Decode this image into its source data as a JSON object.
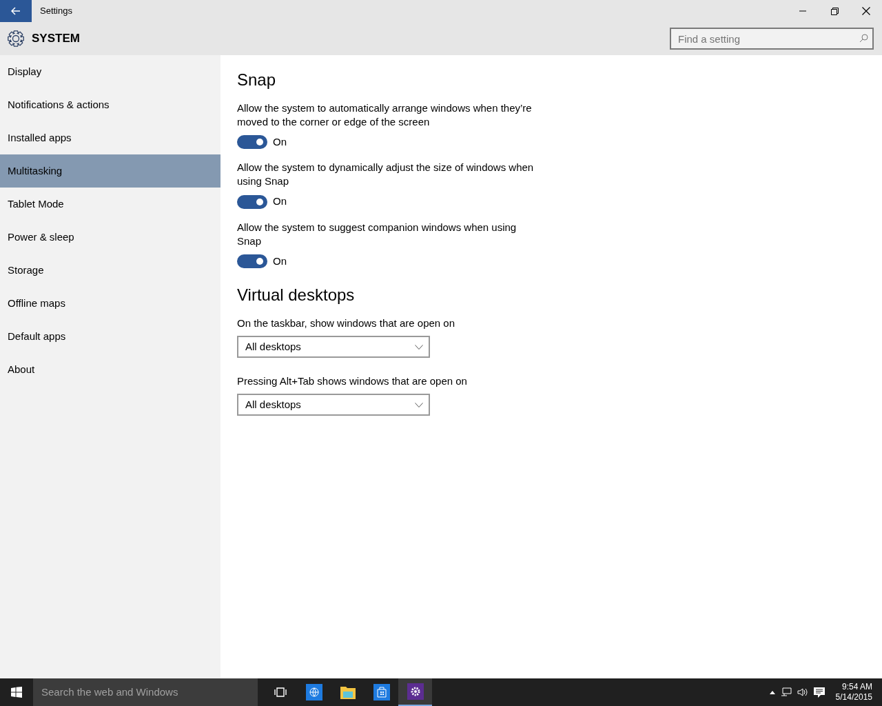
{
  "window": {
    "title": "Settings"
  },
  "header": {
    "title": "SYSTEM",
    "search": {
      "placeholder": "Find a setting"
    }
  },
  "sidebar": {
    "items": [
      {
        "label": "Display",
        "selected": false
      },
      {
        "label": "Notifications & actions",
        "selected": false
      },
      {
        "label": "Installed apps",
        "selected": false
      },
      {
        "label": "Multitasking",
        "selected": true
      },
      {
        "label": "Tablet Mode",
        "selected": false
      },
      {
        "label": "Power & sleep",
        "selected": false
      },
      {
        "label": "Storage",
        "selected": false
      },
      {
        "label": "Offline maps",
        "selected": false
      },
      {
        "label": "Default apps",
        "selected": false
      },
      {
        "label": "About",
        "selected": false
      }
    ]
  },
  "sections": [
    {
      "title": "Snap",
      "settings": [
        {
          "kind": "toggle",
          "label": "Allow the system to automatically arrange windows when they’re moved to the corner or edge of the screen",
          "on": true,
          "state_text": "On"
        },
        {
          "kind": "toggle",
          "label": "Allow the system to dynamically adjust the size of windows when using Snap",
          "on": true,
          "state_text": "On"
        },
        {
          "kind": "toggle",
          "label": "Allow the system to suggest companion windows when using Snap",
          "on": true,
          "state_text": "On"
        }
      ]
    },
    {
      "title": "Virtual desktops",
      "settings": [
        {
          "kind": "dropdown",
          "label": "On the taskbar, show windows that are open on",
          "value": "All desktops"
        },
        {
          "kind": "dropdown",
          "label": "Pressing Alt+Tab shows windows that are open on",
          "value": "All desktops"
        }
      ]
    }
  ],
  "taskbar": {
    "search": {
      "placeholder": "Search the web and Windows"
    },
    "apps": [
      {
        "kind": "taskview",
        "selected": false
      },
      {
        "kind": "browser",
        "selected": false
      },
      {
        "kind": "explorer",
        "selected": false
      },
      {
        "kind": "store",
        "selected": false
      },
      {
        "kind": "settings",
        "selected": true
      }
    ],
    "clock": {
      "time": "9:54 AM",
      "date": "5/14/2015"
    }
  }
}
